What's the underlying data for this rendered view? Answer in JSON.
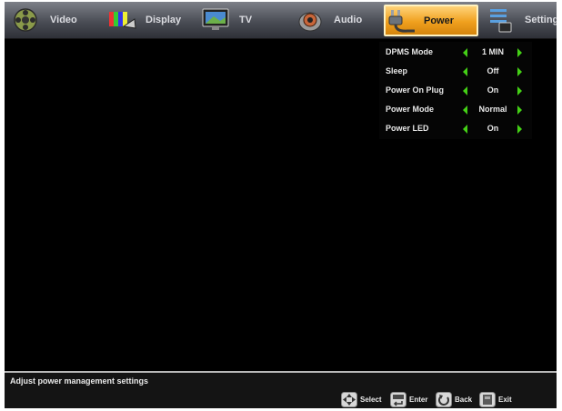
{
  "tabs": [
    {
      "label": "Video",
      "icon": "film-reel-icon"
    },
    {
      "label": "Display",
      "icon": "color-bars-icon"
    },
    {
      "label": "TV",
      "icon": "tv-monitor-icon"
    },
    {
      "label": "Audio",
      "icon": "speaker-icon"
    },
    {
      "label": "Power",
      "icon": "power-plug-icon",
      "active": true
    },
    {
      "label": "Settings",
      "icon": "settings-list-icon"
    }
  ],
  "settings": [
    {
      "label": "DPMS Mode",
      "value": "1 MIN"
    },
    {
      "label": "Sleep",
      "value": "Off"
    },
    {
      "label": "Power On Plug",
      "value": "On"
    },
    {
      "label": "Power Mode",
      "value": "Normal"
    },
    {
      "label": "Power LED",
      "value": "On"
    }
  ],
  "help_text": "Adjust power management settings",
  "hints": [
    {
      "label": "Select",
      "icon": "dpad-icon"
    },
    {
      "label": "Enter",
      "icon": "enter-key-icon"
    },
    {
      "label": "Back",
      "icon": "back-arrow-icon"
    },
    {
      "label": "Exit",
      "icon": "exit-icon"
    }
  ],
  "colors": {
    "accent": "#f0a01e",
    "arrow": "#44d016",
    "background": "#000000"
  }
}
